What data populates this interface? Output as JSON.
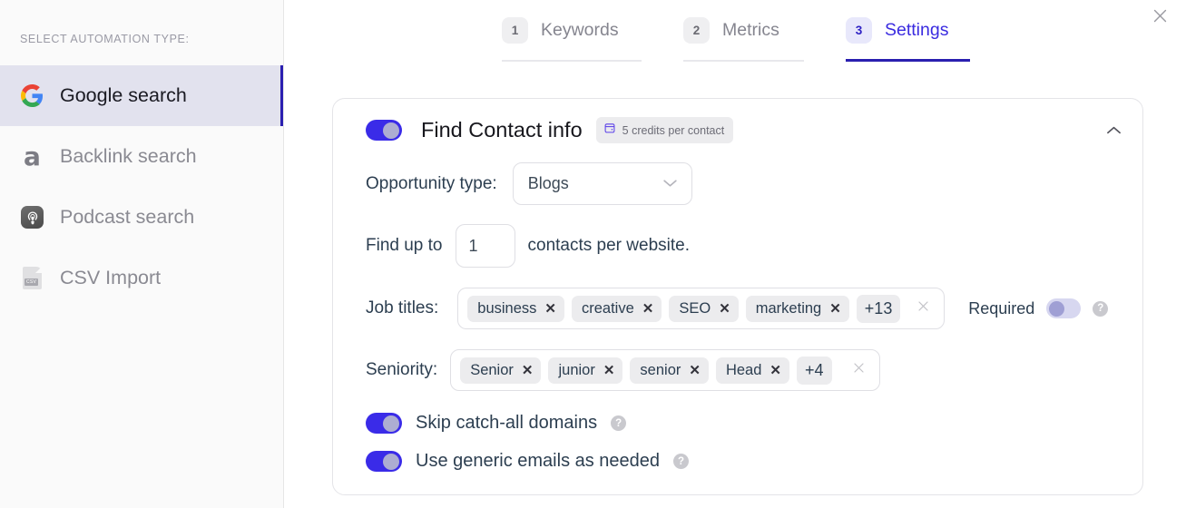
{
  "sidebar": {
    "heading": "SELECT AUTOMATION TYPE:",
    "items": [
      {
        "label": "Google search",
        "icon": "google-icon",
        "active": true
      },
      {
        "label": "Backlink search",
        "icon": "ahrefs-icon",
        "active": false
      },
      {
        "label": "Podcast search",
        "icon": "podcast-icon",
        "active": false
      },
      {
        "label": "CSV Import",
        "icon": "csv-file-icon",
        "active": false
      }
    ],
    "csv_tag": "CSV"
  },
  "header": {
    "close_icon": "close-icon"
  },
  "tabs": [
    {
      "num": "1",
      "label": "Keywords",
      "active": false
    },
    {
      "num": "2",
      "label": "Metrics",
      "active": false
    },
    {
      "num": "3",
      "label": "Settings",
      "active": true
    }
  ],
  "card": {
    "title": "Find Contact info",
    "enabled": true,
    "credits_badge": "5 credits per contact",
    "credits_icon": "wallet-icon",
    "collapse_icon": "chevron-up-icon",
    "opportunity": {
      "label": "Opportunity type:",
      "value": "Blogs",
      "chevron_icon": "chevron-down-icon"
    },
    "find_up_to": {
      "prefix": "Find up to",
      "value": "1",
      "placeholder": "1",
      "suffix": "contacts per website."
    },
    "job_titles": {
      "label": "Job titles:",
      "chips": [
        "business",
        "creative",
        "SEO",
        "marketing"
      ],
      "overflow": "+13",
      "clear_icon": "clear-icon",
      "required_label": "Required",
      "required_on": false,
      "help_icon": "help-icon"
    },
    "seniority": {
      "label": "Seniority:",
      "chips": [
        "Senior",
        "junior",
        "senior",
        "Head"
      ],
      "overflow": "+4",
      "clear_icon": "clear-icon"
    },
    "switches": [
      {
        "label": "Skip catch-all domains",
        "on": true,
        "help_icon": "help-icon"
      },
      {
        "label": "Use generic emails as needed",
        "on": true,
        "help_icon": "help-icon"
      }
    ],
    "chip_remove_glyph": "✕"
  },
  "colors": {
    "accent": "#3a2be8",
    "accent_dark": "#2a1fb0",
    "active_nav_bg": "#e2e2ee",
    "chip_bg": "#ececee",
    "sidebar_bg": "#fafafa"
  }
}
